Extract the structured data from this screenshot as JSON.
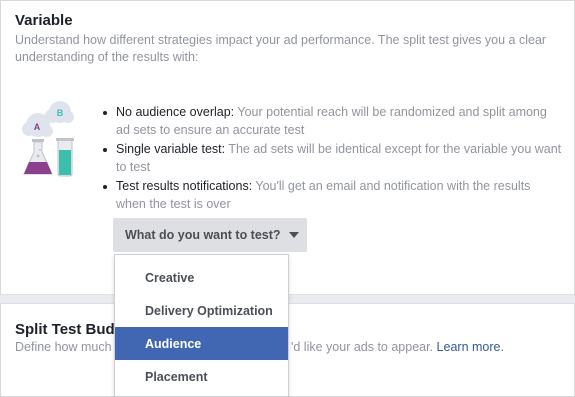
{
  "variable": {
    "title": "Variable",
    "description": "Understand how different strategies impact your ad performance. The split test gives you a clear understanding of the results with:",
    "illustration_labels": {
      "a": "A",
      "b": "B"
    },
    "bullets": [
      {
        "strong": "No audience overlap:",
        "rest": " Your potential reach will be randomized and split among ad sets to ensure an accurate test"
      },
      {
        "strong": "Single variable test:",
        "rest": " The ad sets will be identical except for the variable you want to test"
      },
      {
        "strong": "Test results notifications:",
        "rest": " You'll get an email and notification with the results when the test is over"
      }
    ],
    "dropdown_label": "What do you want to test?"
  },
  "menu": {
    "items": [
      "Creative",
      "Delivery Optimization",
      "Audience",
      "Placement"
    ],
    "selected": "Audience"
  },
  "budget": {
    "title": "Split Test Budg",
    "description_start": "Define how much y",
    "description_end": "'d like your ads to appear.",
    "link": "Learn more."
  },
  "colors": {
    "accent": "#4267b2",
    "link": "#365899",
    "muted_text": "#90949c",
    "button_bg": "#dddfe2"
  }
}
